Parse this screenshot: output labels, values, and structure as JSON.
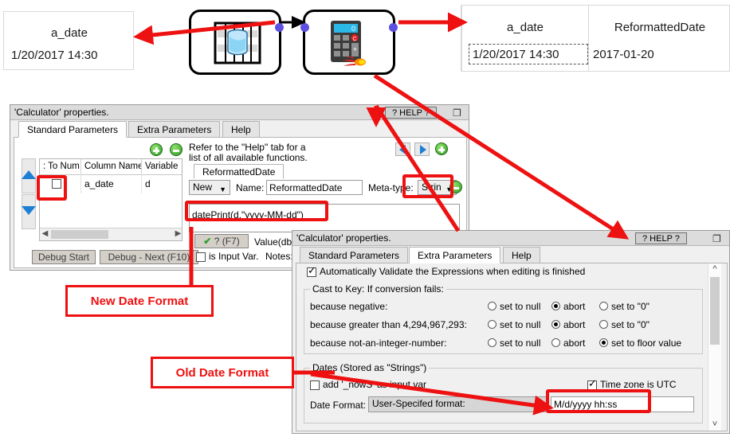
{
  "flow": {
    "left_preview": {
      "column": "a_date",
      "value": "1/20/2017 14:30"
    },
    "right_preview": {
      "columns": [
        "a_date",
        "ReformattedDate"
      ],
      "row": [
        "1/20/2017 14:30",
        "2017-01-20"
      ]
    },
    "nodes": [
      {
        "name": "table-reader-node",
        "icon": "database-table-icon"
      },
      {
        "name": "calculator-node",
        "icon": "calculator-icon"
      }
    ]
  },
  "annotations": {
    "new_date_format": "New Date Format",
    "old_date_format": "Old Date Format",
    "accent_color": "#ee1111"
  },
  "dialog_standard": {
    "title": "'Calculator' properties.",
    "help_button": "? HELP ?",
    "restore_icon": "restore-window-icon",
    "tabs": [
      {
        "label": "Standard Parameters",
        "active": true
      },
      {
        "label": "Extra Parameters",
        "active": false
      },
      {
        "label": "Help",
        "active": false
      }
    ],
    "table": {
      "headers": [
        ": To Num",
        "Column Name",
        "Variable"
      ],
      "rows": [
        {
          "to_num_checked": false,
          "column_name": "a_date",
          "variable": "d"
        }
      ]
    },
    "add_button_icon": "plus-circle-icon",
    "remove_button_icon": "minus-circle-icon",
    "hint_line1": "Refer to the \"Help\" tab for a",
    "hint_line2": "list of all available functions.",
    "expr_tab_label": "ReformattedDate",
    "new_dropdown": "New",
    "name_label": "Name:",
    "name_value": "ReformattedDate",
    "metatype_label": "Meta-type:",
    "metatype_value": "Strin",
    "expression": "datePrint(d,\"yyyy-MM-dd\")",
    "validate_button": "? (F7)",
    "validate_icon": "green-check-icon",
    "value_dbg_label": "Value(dbg):",
    "is_input_var_label": "is Input Var.",
    "is_input_var_checked": false,
    "notes_label": "Notes:",
    "debug_start": "Debug Start",
    "debug_next": "Debug - Next (F10)",
    "nav_prev_icon": "arrow-left-icon",
    "nav_next_icon": "arrow-right-icon"
  },
  "dialog_extra": {
    "title": "'Calculator' properties.",
    "help_button": "? HELP ?",
    "restore_icon": "restore-window-icon",
    "tabs": [
      {
        "label": "Standard Parameters",
        "active": false
      },
      {
        "label": "Extra Parameters",
        "active": true
      },
      {
        "label": "Help",
        "active": false
      }
    ],
    "auto_validate": {
      "label": "Automatically Validate the Expressions when editing is finished",
      "checked": true
    },
    "cast_group": {
      "label": "Cast to Key: If conversion fails:",
      "rows": [
        {
          "label": "because negative:",
          "options": [
            "set to null",
            "abort",
            "set to \"0\""
          ],
          "selected": 1
        },
        {
          "label": "because greater than 4,294,967,293:",
          "options": [
            "set to null",
            "abort",
            "set to \"0\""
          ],
          "selected": 1
        },
        {
          "label": "because not-an-integer-number:",
          "options": [
            "set to null",
            "abort",
            "set to floor value"
          ],
          "selected": 2
        }
      ]
    },
    "dates_group": {
      "label": "Dates (Stored as \"Strings\")",
      "add_nows": {
        "label": "add '_nowS' as input var",
        "checked": false
      },
      "time_zone_utc": {
        "label": "Time zone is UTC",
        "checked": true
      },
      "date_format_label": "Date Format:",
      "date_format_mode": "User-Specifed format:",
      "date_format_value": "M/d/yyyy hh:ss"
    },
    "scroll_up_icon": "chevron-up-icon",
    "scroll_down_icon": "chevron-down-icon"
  }
}
